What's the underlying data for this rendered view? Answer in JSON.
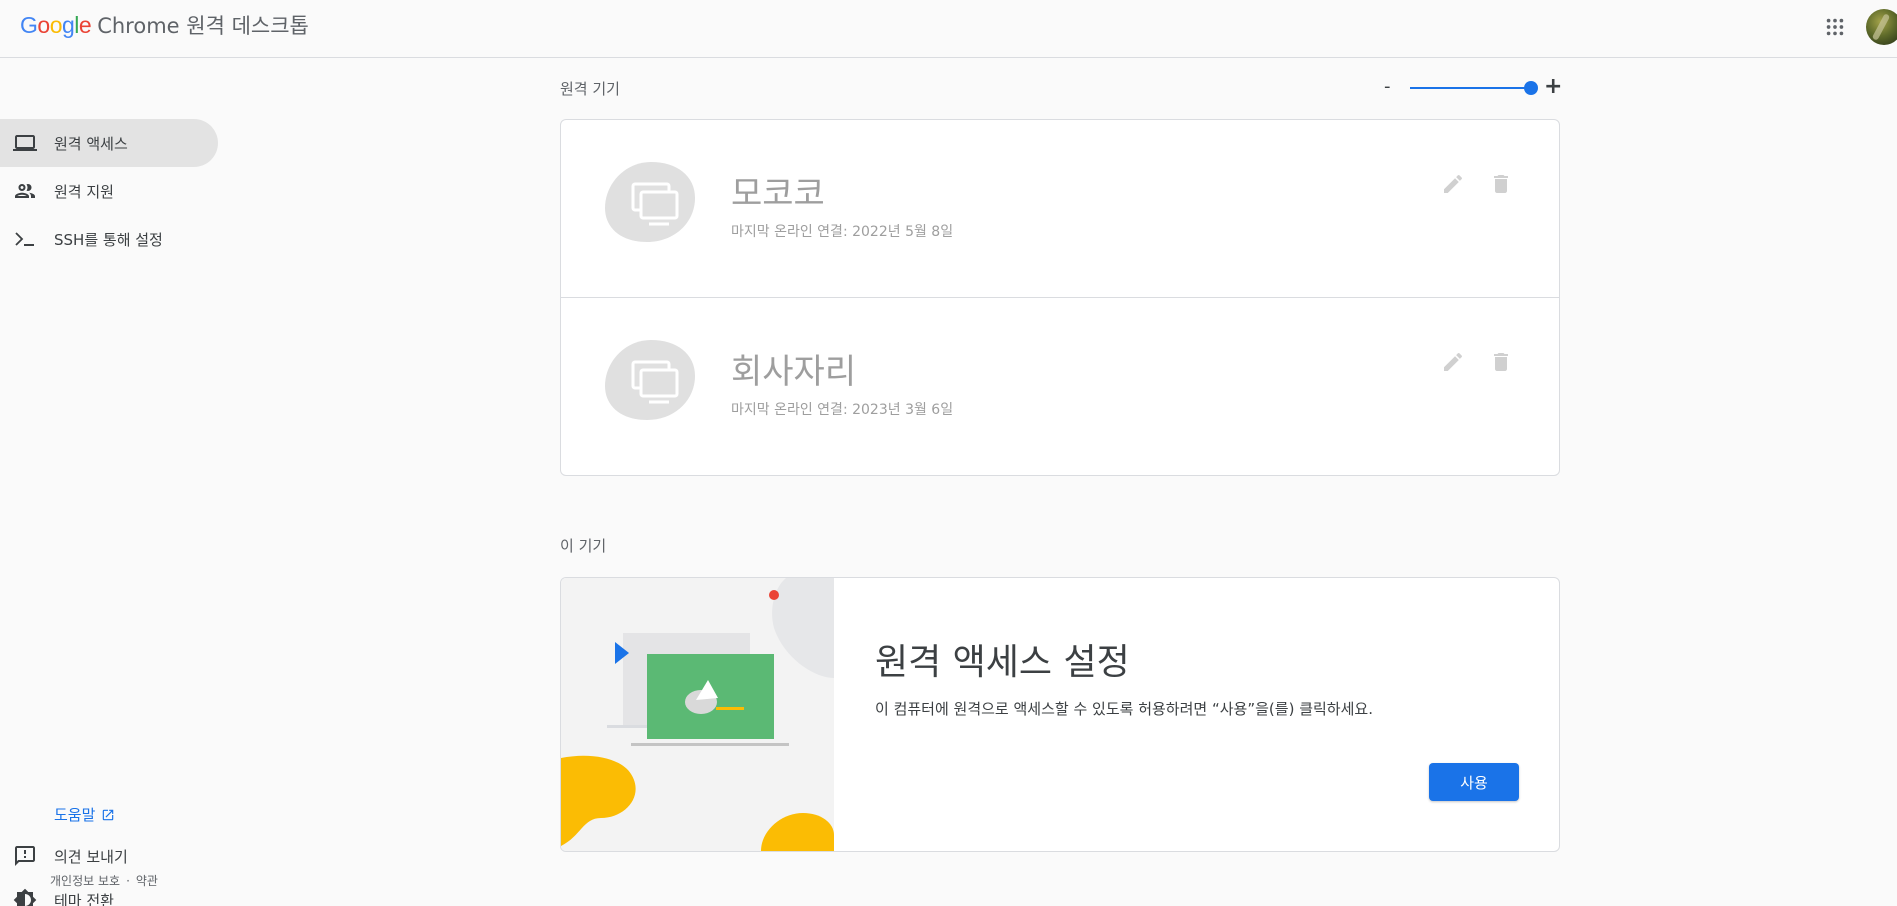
{
  "header": {
    "brand_google": [
      "G",
      "o",
      "o",
      "g",
      "l",
      "e"
    ],
    "brand_product": "Chrome 원격 데스크톱",
    "apps_icon": "apps-grid-icon",
    "avatar_icon": "avatar"
  },
  "sidebar": {
    "items": [
      {
        "label": "원격 액세스",
        "icon": "laptop-icon",
        "active": true
      },
      {
        "label": "원격 지원",
        "icon": "people-icon",
        "active": false
      },
      {
        "label": "SSH를 통해 설정",
        "icon": "terminal-icon",
        "active": false
      }
    ],
    "help_label": "도움말",
    "feedback_label": "의견 보내기",
    "theme_label": "테마 전환",
    "privacy_label": "개인정보 보호",
    "separator": "·",
    "terms_label": "약관"
  },
  "remote_devices": {
    "title": "원격 기기",
    "zoom_minus": "-",
    "zoom_plus": "+",
    "zoom_level": 1.0,
    "devices": [
      {
        "name": "모코코",
        "status": "마지막 온라인 연결: 2022년 5월 8일"
      },
      {
        "name": "회사자리",
        "status": "마지막 온라인 연결: 2023년 3월 6일"
      }
    ]
  },
  "this_device": {
    "title": "이 기기",
    "setup_title": "원격 액세스 설정",
    "setup_desc": "이 컴퓨터에 원격으로 액세스할 수 있도록 허용하려면 “사용”을(를) 클릭하세요.",
    "enable_label": "사용"
  },
  "colors": {
    "accent": "#1a73e8",
    "active_nav": "#e3e3e3",
    "illus_green": "#5bb974",
    "illus_yellow": "#fbbc04"
  }
}
